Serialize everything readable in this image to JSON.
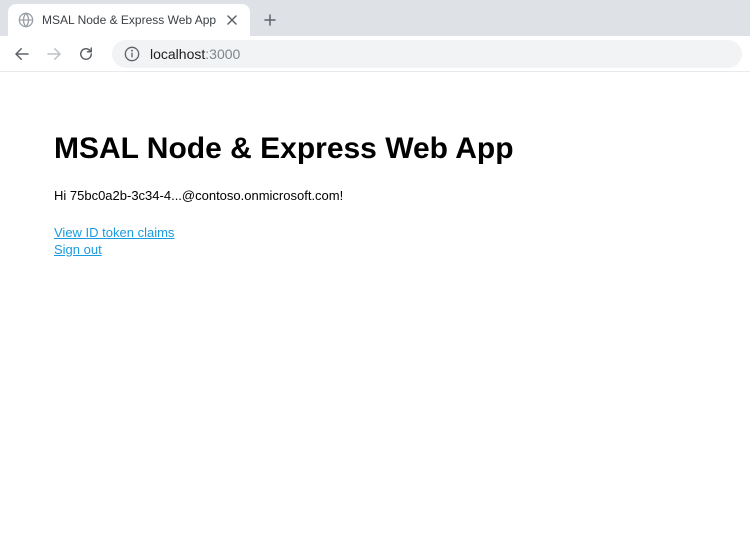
{
  "browser": {
    "tab_title": "MSAL Node & Express Web App",
    "url_host": "localhost",
    "url_port": ":3000"
  },
  "page": {
    "heading": "MSAL Node & Express Web App",
    "greeting": "Hi 75bc0a2b-3c34-4...@contoso.onmicrosoft.com!",
    "links": {
      "view_claims": "View ID token claims",
      "sign_out": "Sign out"
    }
  }
}
